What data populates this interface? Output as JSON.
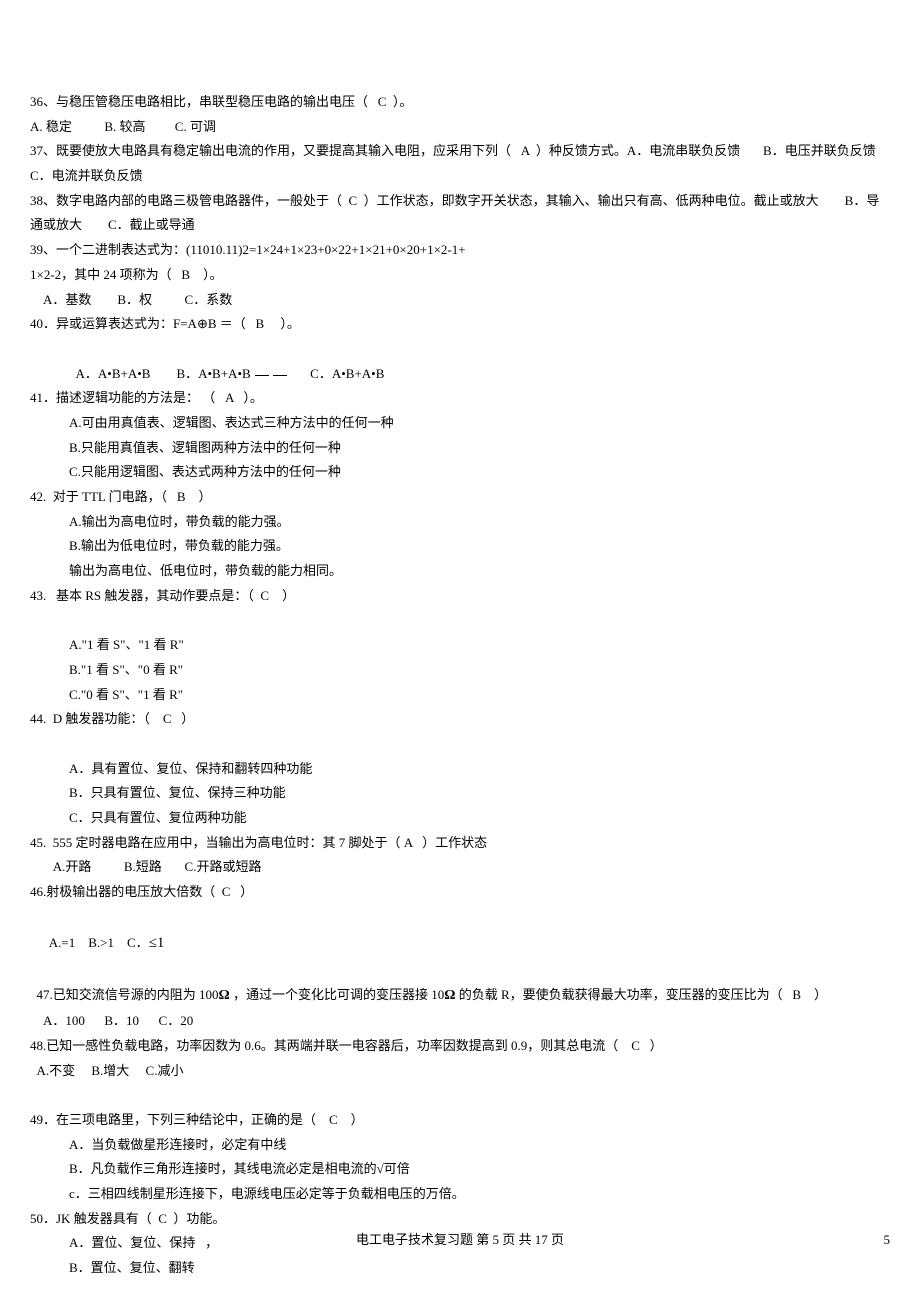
{
  "lines": {
    "q36": "36、与稳压管稳压电路相比，串联型稳压电路的输出电压（   C  ）。",
    "q36_opts": "A. 稳定          B. 较高         C. 可调",
    "q37": "37、既要使放大电路具有稳定输出电流的作用，又要提高其输入电阻，应采用下列（   A  ）种反馈方式。A．电流串联负反馈       B．电压并联负反馈       C．电流并联负反馈",
    "q38": "38、数字电路内部的电路三极管电路器件，一般处于（  C  ）工作状态，即数字开关状态，其输入、输出只有高、低两种电位。截止或放大        B．导通或放大        C．截止或导通",
    "q39_a": "39、一个二进制表达式为：(11010.11)2=1×24+1×23+0×22+1×21+0×20+1×2-1+",
    "q39_b": "1×2-2，其中 24 项称为（   B    ）。",
    "q39_opts": "    A．基数        B．权          C．系数",
    "q40": "40．异或运算表达式为：F=A⊕B ＝（   B     ）。",
    "q40_opts_a": "A．A•B+A•B        B．A•B+A•B",
    "q40_opts_c": "      C．A•B+A•B",
    "q41": "41．描述逻辑功能的方法是： （   A   ）。",
    "q41_a": "A.可由用真值表、逻辑图、表达式三种方法中的任何一种",
    "q41_b": "B.只能用真值表、逻辑图两种方法中的任何一种",
    "q41_c": "C.只能用逻辑图、表达式两种方法中的任何一种",
    "q42": "42.  对于 TTL 门电路，（   B    ）",
    "q42_a": "A.输出为高电位时，带负载的能力强。",
    "q42_b": "B.输出为低电位时，带负载的能力强。",
    "q42_c": "输出为高电位、低电位时，带负载的能力相同。",
    "q43": "43.   基本 RS 触发器，其动作要点是：（  C    ）",
    "q43_a": "A.\"1 看 S\"、\"1 看 R\"",
    "q43_b": "B.\"1 看 S\"、\"0 看 R\"",
    "q43_c": "C.\"0 看 S\"、\"1 看 R\"",
    "q44": "44.  D 触发器功能：（    C   ）",
    "q44_a": "A．具有置位、复位、保持和翻转四种功能",
    "q44_b": "B．只具有置位、复位、保持三种功能",
    "q44_c": "C．只具有置位、复位两种功能",
    "q45": "45.  555 定时器电路在应用中，当输出为高电位时：其 7 脚处于（ A   ）工作状态",
    "q45_opts": "       A.开路          B.短路       C.开路或短路",
    "q46": "46.射极输出器的电压放大倍数（  C   ）",
    "q46_opts_pre": "    A.=1    B.>1    C．",
    "q46_opts_le": "≤1",
    "q47_pre": "47.已知交流信号源的内阻为 100",
    "q47_mid": " ，通过一个变化比可调的变压器接 10",
    "q47_post": " 的负载 R，要使负载获得最大功率，变压器的变压比为（   B    ）",
    "q47_opts": "    A．100      B．10      C．20",
    "q48": "48.已知一感性负载电路，功率因数为 0.6。其两端并联一电容器后，功率因数提高到 0.9，则其总电流（    C   ）",
    "q48_opts": "  A.不变     B.增大     C.减小",
    "q49": "49．在三项电路里，下列三种结论中，正确的是（    C    ）",
    "q49_a": "A．当负载做星形连接时，必定有中线",
    "q49_b": "B．凡负载作三角形连接时，其线电流必定是相电流的√可倍",
    "q49_c": "c．三相四线制星形连接下，电源线电压必定等于负载相电压的万倍。",
    "q50": "50．JK 触发器具有（  C  ）功能。",
    "q50_a": "A．置位、复位、保持   ，",
    "q50_b": "B．置位、复位、翻转"
  },
  "footer": "电工电子技术复习题  第 5 页   共 17 页",
  "page_num": "5",
  "glyphs": {
    "omega": "Ω"
  }
}
